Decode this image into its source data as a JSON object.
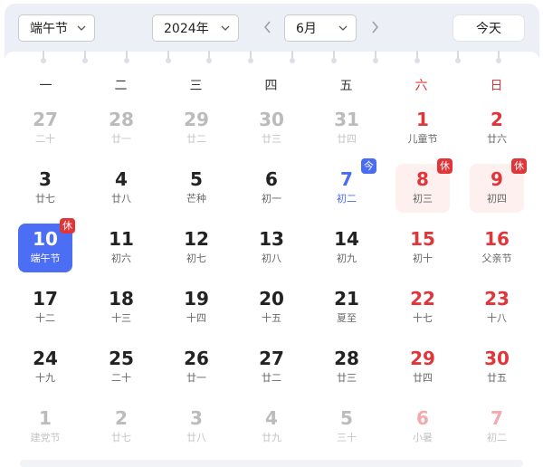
{
  "toolbar": {
    "holiday_select": "端午节",
    "year_select": "2024年",
    "month_select": "6月",
    "today_label": "今天",
    "prev_icon": "chevron-left-icon",
    "next_icon": "chevron-right-icon",
    "caret_icon": "chevron-down-icon"
  },
  "weekdays": [
    {
      "label": "一",
      "weekend": false
    },
    {
      "label": "二",
      "weekend": false
    },
    {
      "label": "三",
      "weekend": false
    },
    {
      "label": "四",
      "weekend": false
    },
    {
      "label": "五",
      "weekend": false
    },
    {
      "label": "六",
      "weekend": true
    },
    {
      "label": "日",
      "weekend": true
    }
  ],
  "colors": {
    "accent": "#4c6ef5",
    "weekend_red": "#e0363a",
    "rest_badge": "#e0363a",
    "work_badge": "#4a6cf0",
    "rest_bg": "#fdf0ef"
  },
  "days": [
    {
      "day": "27",
      "sub": "二十",
      "tone": "dim"
    },
    {
      "day": "28",
      "sub": "廿一",
      "tone": "dim"
    },
    {
      "day": "29",
      "sub": "廿二",
      "tone": "dim"
    },
    {
      "day": "30",
      "sub": "廿三",
      "tone": "dim"
    },
    {
      "day": "31",
      "sub": "廿四",
      "tone": "dim"
    },
    {
      "day": "1",
      "sub": "儿童节",
      "tone": "red"
    },
    {
      "day": "2",
      "sub": "廿六",
      "tone": "red"
    },
    {
      "day": "3",
      "sub": "廿七",
      "tone": "normal"
    },
    {
      "day": "4",
      "sub": "廿八",
      "tone": "normal"
    },
    {
      "day": "5",
      "sub": "芒种",
      "tone": "normal"
    },
    {
      "day": "6",
      "sub": "初一",
      "tone": "normal"
    },
    {
      "day": "7",
      "sub": "初二",
      "tone": "blue",
      "badge": "今",
      "badge_kind": "work"
    },
    {
      "day": "8",
      "sub": "初三",
      "tone": "red",
      "badge": "休",
      "badge_kind": "rest",
      "rest": true
    },
    {
      "day": "9",
      "sub": "初四",
      "tone": "red",
      "badge": "休",
      "badge_kind": "rest",
      "rest": true
    },
    {
      "day": "10",
      "sub": "端午节",
      "tone": "normal",
      "badge": "休",
      "badge_kind": "rest",
      "selected": true
    },
    {
      "day": "11",
      "sub": "初六",
      "tone": "normal"
    },
    {
      "day": "12",
      "sub": "初七",
      "tone": "normal"
    },
    {
      "day": "13",
      "sub": "初八",
      "tone": "normal"
    },
    {
      "day": "14",
      "sub": "初九",
      "tone": "normal"
    },
    {
      "day": "15",
      "sub": "初十",
      "tone": "red"
    },
    {
      "day": "16",
      "sub": "父亲节",
      "tone": "red"
    },
    {
      "day": "17",
      "sub": "十二",
      "tone": "normal"
    },
    {
      "day": "18",
      "sub": "十三",
      "tone": "normal"
    },
    {
      "day": "19",
      "sub": "十四",
      "tone": "normal"
    },
    {
      "day": "20",
      "sub": "十五",
      "tone": "normal"
    },
    {
      "day": "21",
      "sub": "夏至",
      "tone": "normal"
    },
    {
      "day": "22",
      "sub": "十七",
      "tone": "red"
    },
    {
      "day": "23",
      "sub": "十八",
      "tone": "red"
    },
    {
      "day": "24",
      "sub": "十九",
      "tone": "normal"
    },
    {
      "day": "25",
      "sub": "二十",
      "tone": "normal"
    },
    {
      "day": "26",
      "sub": "廿一",
      "tone": "normal"
    },
    {
      "day": "27",
      "sub": "廿二",
      "tone": "normal"
    },
    {
      "day": "28",
      "sub": "廿三",
      "tone": "normal"
    },
    {
      "day": "29",
      "sub": "廿四",
      "tone": "red"
    },
    {
      "day": "30",
      "sub": "廿五",
      "tone": "red"
    },
    {
      "day": "1",
      "sub": "建党节",
      "tone": "dim"
    },
    {
      "day": "2",
      "sub": "廿七",
      "tone": "dim"
    },
    {
      "day": "3",
      "sub": "廿八",
      "tone": "dim"
    },
    {
      "day": "4",
      "sub": "廿九",
      "tone": "dim"
    },
    {
      "day": "5",
      "sub": "三十",
      "tone": "dim"
    },
    {
      "day": "6",
      "sub": "小暑",
      "tone": "dimred"
    },
    {
      "day": "7",
      "sub": "初二",
      "tone": "dimred"
    }
  ]
}
